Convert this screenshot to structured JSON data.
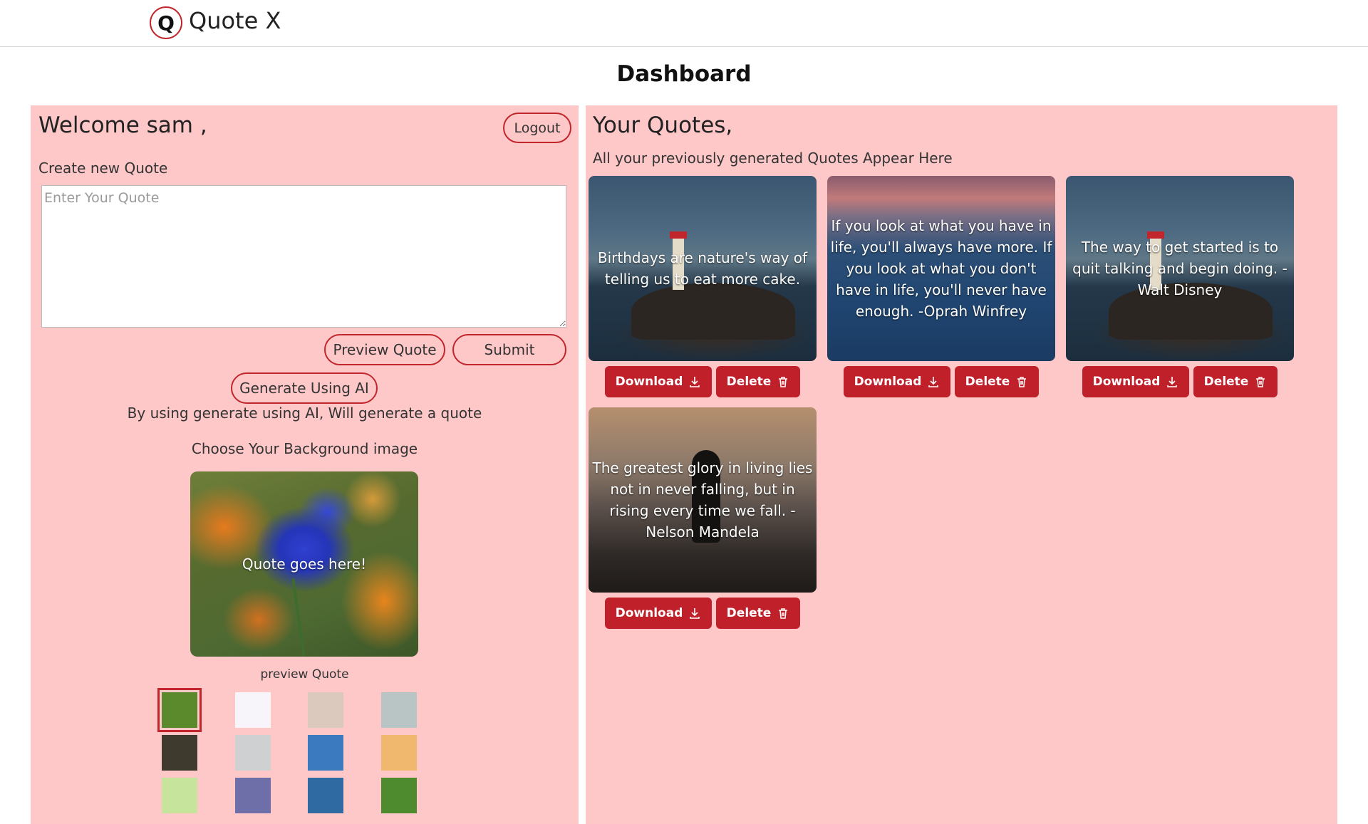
{
  "header": {
    "logo_letter": "Q",
    "brand": "Quote X"
  },
  "page_title": "Dashboard",
  "left": {
    "welcome": "Welcome sam ,",
    "logout_label": "Logout",
    "create_label": "Create new Quote",
    "quote_input": {
      "placeholder": "Enter Your Quote",
      "value": ""
    },
    "preview_label": "Preview Quote",
    "submit_label": "Submit",
    "generate_label": "Generate Using AI",
    "ai_hint": "By using generate using AI, Will generate a quote",
    "bg_label": "Choose Your Background image",
    "preview_text": "Quote goes here!",
    "preview_caption": "preview Quote",
    "swatches": [
      {
        "color": "#5b8a2c",
        "selected": true
      },
      {
        "color": "#f7f5fa",
        "selected": false
      },
      {
        "color": "#dcc9bd",
        "selected": false
      },
      {
        "color": "#b9c4c4",
        "selected": false
      },
      {
        "color": "#3f3a2e",
        "selected": false
      },
      {
        "color": "#cfd0d2",
        "selected": false
      },
      {
        "color": "#3c7ac0",
        "selected": false
      },
      {
        "color": "#f0b86e",
        "selected": false
      },
      {
        "color": "#c6e49b",
        "selected": false
      },
      {
        "color": "#6e6ea8",
        "selected": false
      },
      {
        "color": "#2f6aa3",
        "selected": false
      },
      {
        "color": "#4e8a2e",
        "selected": false
      }
    ]
  },
  "right": {
    "title": "Your Quotes,",
    "subtitle": "All your previously generated Quotes Appear Here",
    "download_label": "Download",
    "delete_label": "Delete",
    "quotes": [
      {
        "text": "Birthdays are nature's way of telling us to eat more cake."
      },
      {
        "text": "If you look at what you have in life, you'll always have more. If you look at what you don't have in life, you'll never have enough. -Oprah Winfrey"
      },
      {
        "text": "The way to get started is to quit talking and begin doing. -Walt Disney"
      },
      {
        "text": "The greatest glory in living lies not in never falling, but in rising every time we fall. -Nelson Mandela"
      }
    ]
  }
}
